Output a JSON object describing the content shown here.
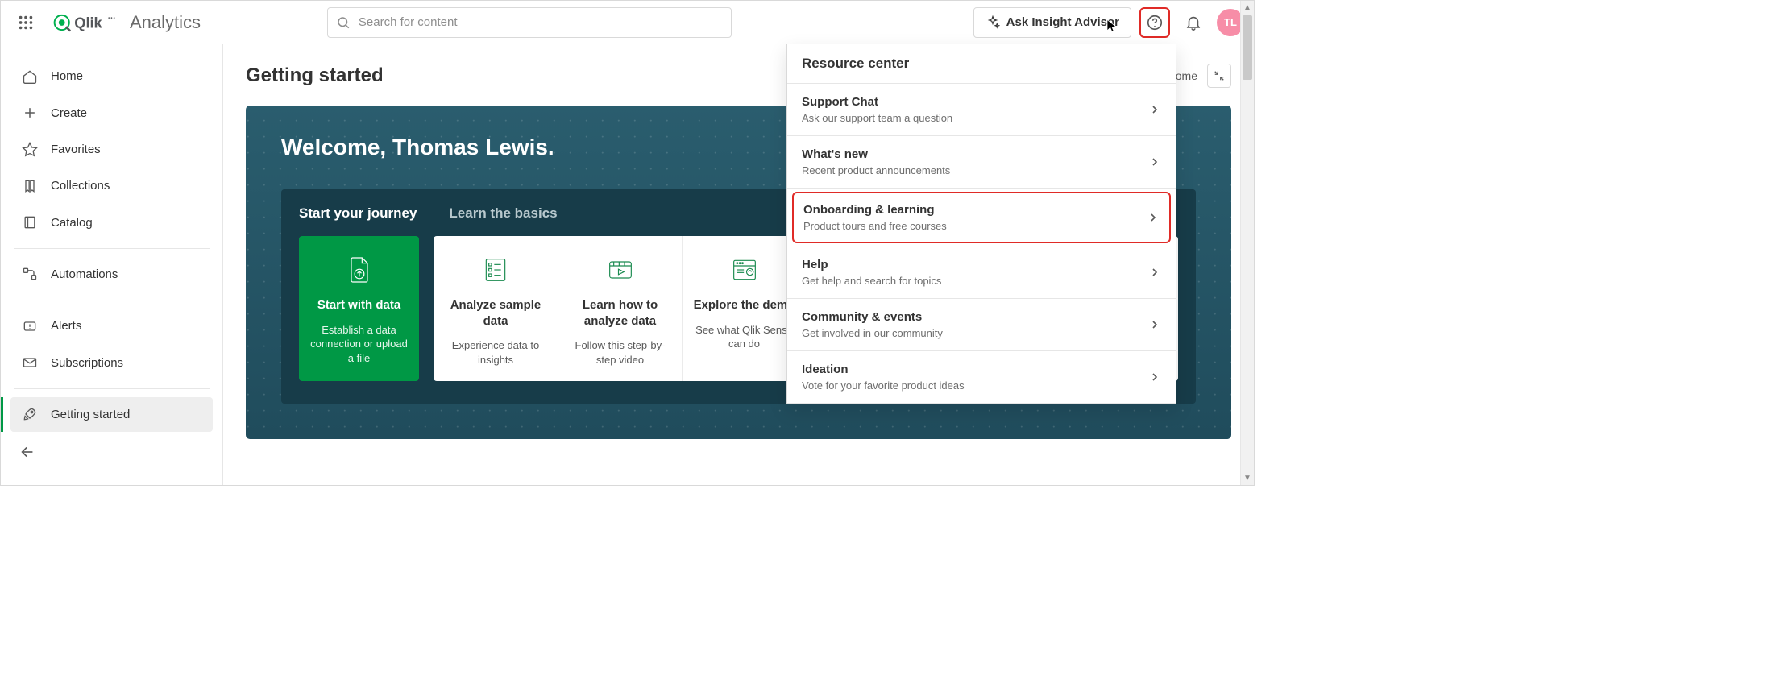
{
  "brand": {
    "product": "Analytics"
  },
  "search": {
    "placeholder": "Search for content",
    "value": ""
  },
  "topbar": {
    "ask_label": "Ask Insight Advisor",
    "avatar_initials": "TL"
  },
  "sidebar": {
    "items": [
      {
        "id": "home",
        "label": "Home"
      },
      {
        "id": "create",
        "label": "Create"
      },
      {
        "id": "favorites",
        "label": "Favorites"
      },
      {
        "id": "collections",
        "label": "Collections"
      },
      {
        "id": "catalog",
        "label": "Catalog"
      },
      {
        "id": "automations",
        "label": "Automations"
      },
      {
        "id": "alerts",
        "label": "Alerts"
      },
      {
        "id": "subscriptions",
        "label": "Subscriptions"
      },
      {
        "id": "getting-started",
        "label": "Getting started"
      }
    ]
  },
  "main": {
    "title": "Getting started",
    "welcome_label_partial": "lcome",
    "hero_heading": "Welcome, Thomas Lewis.",
    "journey_tabs": [
      {
        "label": "Start your journey",
        "active": true
      },
      {
        "label": "Learn the basics",
        "active": false
      }
    ],
    "cards": [
      {
        "id": "start-data",
        "title": "Start with data",
        "sub": "Establish a data connection or upload a file",
        "primary": true
      },
      {
        "id": "analyze",
        "title": "Analyze sample data",
        "sub": "Experience data to insights"
      },
      {
        "id": "howto",
        "title": "Learn how to analyze data",
        "sub": "Follow this step-by-step video"
      },
      {
        "id": "demo",
        "title": "Explore the demo",
        "sub": "See what Qlik Sense can do"
      }
    ]
  },
  "resource_center": {
    "title": "Resource center",
    "items": [
      {
        "id": "support-chat",
        "title": "Support Chat",
        "desc": "Ask our support team a question"
      },
      {
        "id": "whats-new",
        "title": "What's new",
        "desc": "Recent product announcements"
      },
      {
        "id": "onboarding",
        "title": "Onboarding & learning",
        "desc": "Product tours and free courses",
        "highlighted": true
      },
      {
        "id": "help",
        "title": "Help",
        "desc": "Get help and search for topics"
      },
      {
        "id": "community",
        "title": "Community & events",
        "desc": "Get involved in our community"
      },
      {
        "id": "ideation",
        "title": "Ideation",
        "desc": "Vote for your favorite product ideas"
      }
    ]
  }
}
